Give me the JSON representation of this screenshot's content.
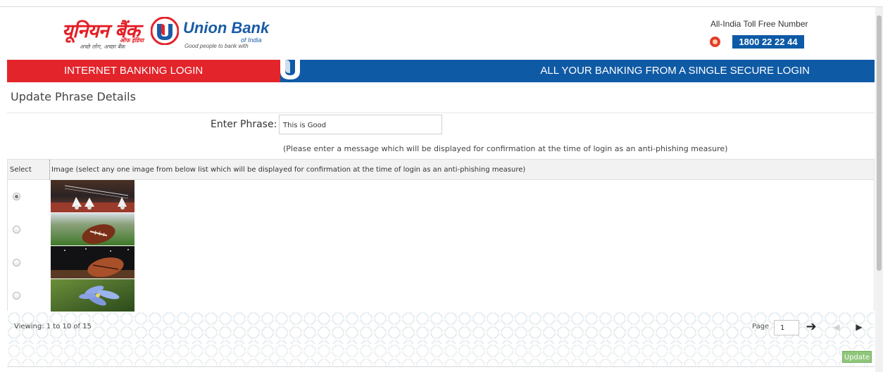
{
  "header": {
    "logo_hindi": "यूनियन बैंक",
    "logo_hindi_sub": "ऑफ इंडिया",
    "logo_hindi_tagline": "अच्छे लोग, अच्छा बैंक",
    "logo_english": "Union Bank",
    "logo_english_sub": "of India",
    "logo_english_tagline": "Good people to bank with",
    "tollfree_label": "All-India Toll Free Number",
    "tollfree_number": "1800 22 22 44"
  },
  "banner": {
    "left_text": "INTERNET BANKING LOGIN",
    "right_text": "ALL YOUR BANKING FROM A SINGLE SECURE LOGIN",
    "colors": {
      "red": "#e3242b",
      "blue": "#0f5aa5"
    }
  },
  "page": {
    "title": "Update Phrase Details",
    "phrase_label": "Enter Phrase:",
    "phrase_value": "This is Good",
    "phrase_help": "(Please enter a message which will be displayed for confirmation at the time of login as an anti-phishing measure)"
  },
  "grid": {
    "columns": [
      "Select",
      "Image (select any one image from below list which will be displayed for confirmation at the time of login as an anti-phishing measure)"
    ],
    "rows": [
      {
        "selected": true,
        "image": "badminton-shuttlecocks"
      },
      {
        "selected": false,
        "image": "rugby-ball-on-grass"
      },
      {
        "selected": false,
        "image": "rugby-ball-dark"
      },
      {
        "selected": false,
        "image": "blue-flower"
      }
    ]
  },
  "pager": {
    "viewing": "Viewing: 1 to 10 of 15",
    "page_label": "Page",
    "page_value": "1"
  },
  "actions": {
    "update_label": "Update"
  }
}
